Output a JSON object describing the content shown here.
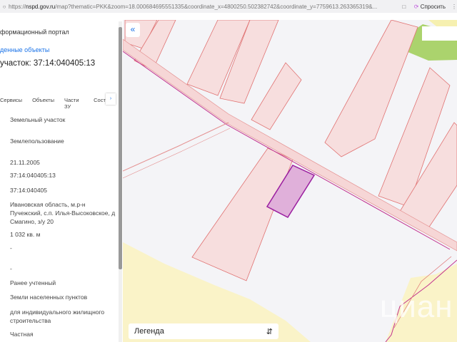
{
  "browser": {
    "url_prefix": "https://",
    "url_host": "nspd.gov.ru",
    "url_rest": "/map?thematic=PKK&zoom=18.000684695551335&coordinate_x=4800250.502382742&coordinate_y=7759613.263365319&...",
    "ask_label": "Спросить"
  },
  "panel": {
    "title": "формационный портал",
    "found_link": "денные объекты",
    "heading": "участок: 37:14:040405:13",
    "tabs": [
      "Сервисы",
      "Объекты",
      "Части ЗУ",
      "Соста"
    ],
    "values": [
      "Земельный участок",
      "Землепользование",
      "21.11.2005",
      "37:14:040405:13",
      "37:14:040405",
      "Ивановская область, м.р-н Пучежский, с.п. Илья-Высоковское, д Смагино, з/у 20",
      "1 032 кв. м",
      "-",
      "-",
      "Ранее учтенный",
      "Земли населенных пунктов",
      "для индивидуального жилищного строительства",
      "Частная"
    ]
  },
  "map": {
    "legend_label": "Легенда",
    "watermark": "циан",
    "colors": {
      "parcel": "#f7dede",
      "parcel_stroke": "#e07272",
      "selected": "#e0b0da",
      "selected_stroke": "#9b1fa0",
      "road": "#c2318f",
      "yellow": "#faf3c8",
      "green": "#9dcc55"
    }
  }
}
